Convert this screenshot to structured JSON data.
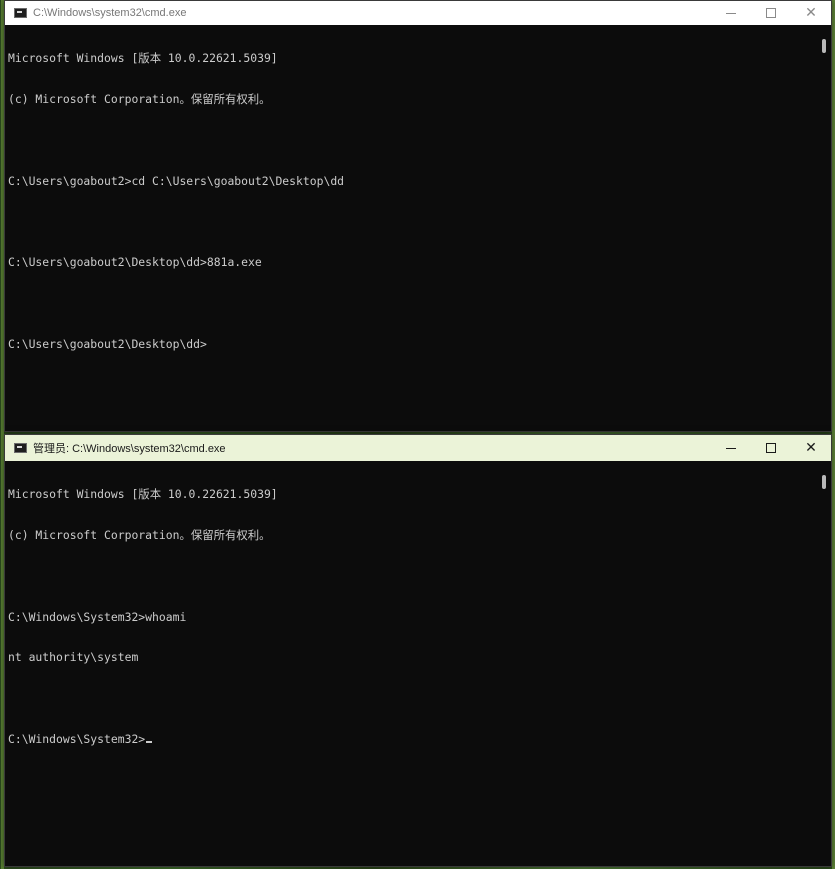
{
  "top_window": {
    "title": "C:\\Windows\\system32\\cmd.exe",
    "lines": [
      "Microsoft Windows [版本 10.0.22621.5039]",
      "(c) Microsoft Corporation。保留所有权利。",
      "",
      "C:\\Users\\goabout2>cd C:\\Users\\goabout2\\Desktop\\dd",
      "",
      "C:\\Users\\goabout2\\Desktop\\dd>881a.exe",
      "",
      "C:\\Users\\goabout2\\Desktop\\dd>"
    ]
  },
  "bottom_window": {
    "title": "管理员: C:\\Windows\\system32\\cmd.exe",
    "lines": [
      "Microsoft Windows [版本 10.0.22621.5039]",
      "(c) Microsoft Corporation。保留所有权利。",
      "",
      "C:\\Windows\\System32>whoami",
      "nt authority\\system",
      "",
      "C:\\Windows\\System32>"
    ]
  },
  "controls": {
    "minimize_icon": "minimize-icon",
    "maximize_icon": "maximize-icon",
    "close_icon": "close-icon",
    "close_glyph": "✕"
  },
  "colors": {
    "console_bg": "#0c0c0c",
    "console_text": "#cccccc",
    "active_titlebar": "#ebf3d8",
    "inactive_titlebar": "#ffffff"
  }
}
